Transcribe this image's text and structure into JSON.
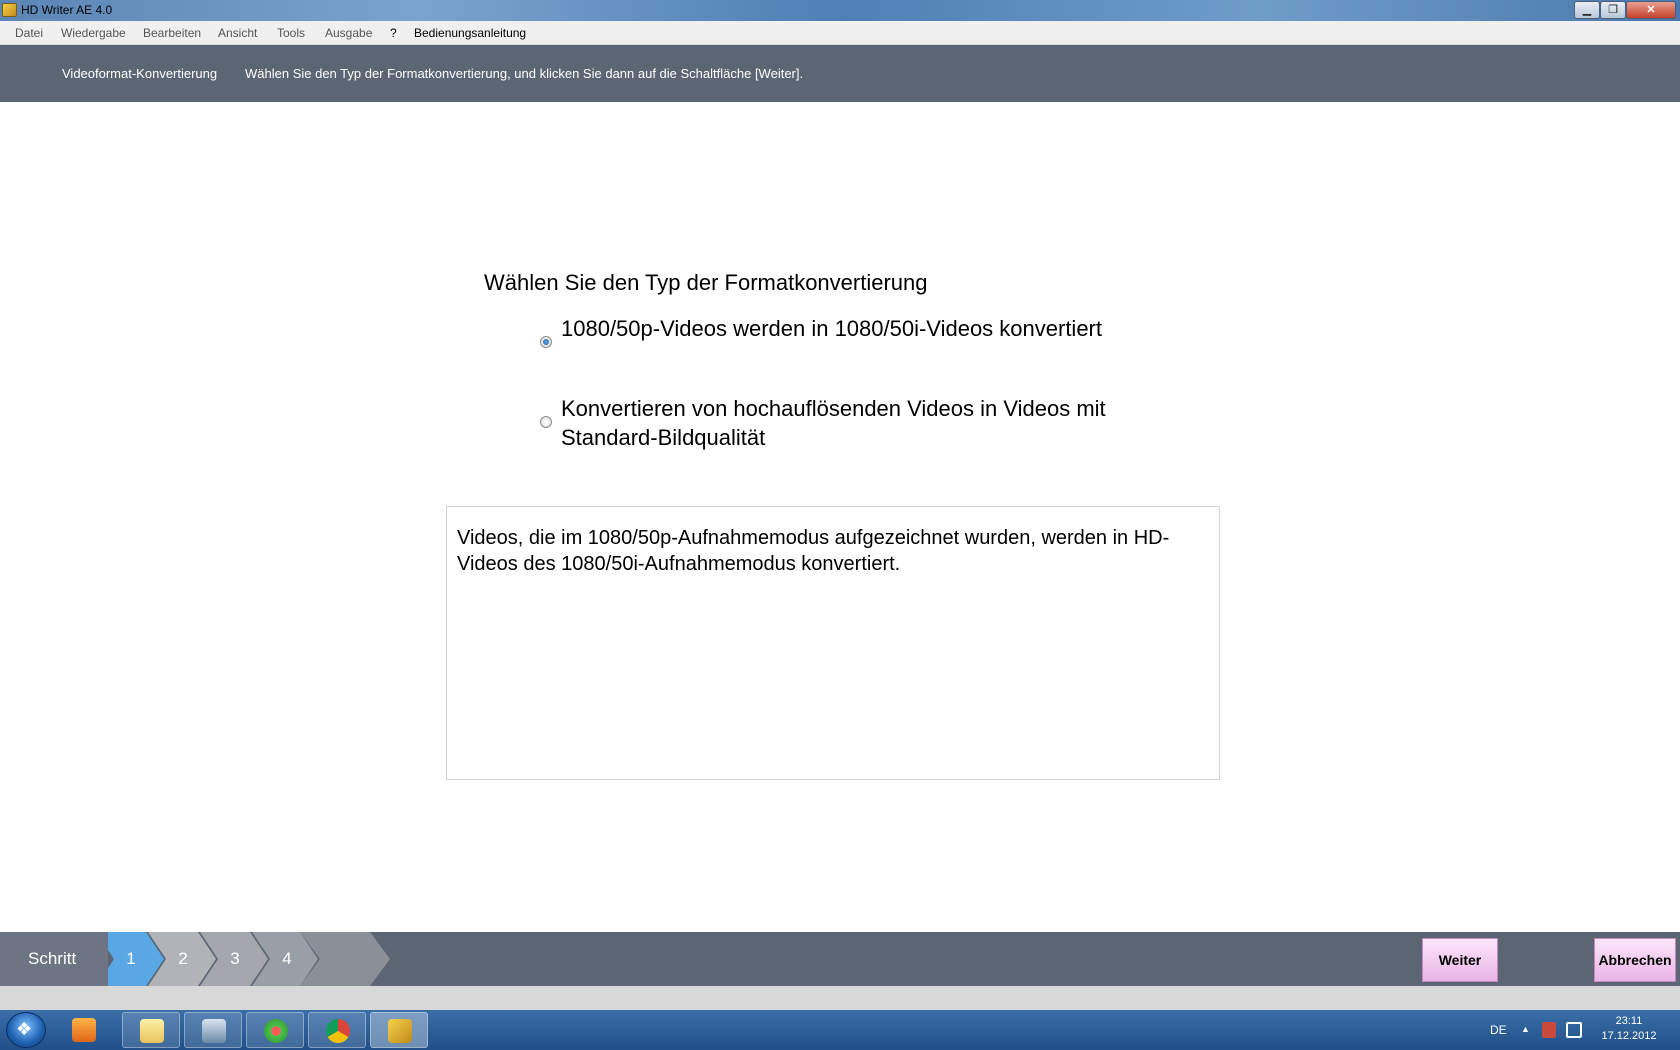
{
  "window": {
    "title": "HD Writer AE 4.0",
    "min_glyph": "▁",
    "max_glyph": "❐",
    "close_glyph": "✕"
  },
  "menu": {
    "items": [
      "Datei",
      "Wiedergabe",
      "Bearbeiten",
      "Ansicht",
      "Tools",
      "Ausgabe",
      "?",
      "Bedienungsanleitung"
    ]
  },
  "header": {
    "title": "Videoformat-Konvertierung",
    "instruction": "Wählen Sie den Typ der Formatkonvertierung, und klicken Sie dann auf die Schaltfläche [Weiter]."
  },
  "content": {
    "question": "Wählen Sie den Typ der Formatkonvertierung",
    "options": [
      {
        "label": "1080/50p-Videos werden in 1080/50i-Videos konvertiert",
        "selected": true
      },
      {
        "label": "Konvertieren von hochauflösenden Videos in Videos mit Standard-Bildqualität",
        "selected": false
      }
    ],
    "description": "Videos, die im 1080/50p-Aufnahmemodus aufgezeichnet wurden, werden in HD-Videos des 1080/50i-Aufnahmemodus konvertiert."
  },
  "steps": {
    "label": "Schritt",
    "items": [
      "1",
      "2",
      "3",
      "4"
    ],
    "active_index": 0
  },
  "buttons": {
    "next": "Weiter",
    "cancel": "Abbrechen"
  },
  "taskbar": {
    "start_glyph": "❖",
    "apps": [
      "media-player-icon",
      "file-explorer-icon",
      "remote-desktop-icon",
      "icq-icon",
      "chrome-icon",
      "hd-writer-icon"
    ],
    "language": "DE",
    "tray_arrow": "▲",
    "time": "23:11",
    "date": "17.12.2012"
  },
  "colors": {
    "header_bg": "#5c6574",
    "step_active": "#5aa7e6",
    "button_bg": "#e9b4e6"
  }
}
